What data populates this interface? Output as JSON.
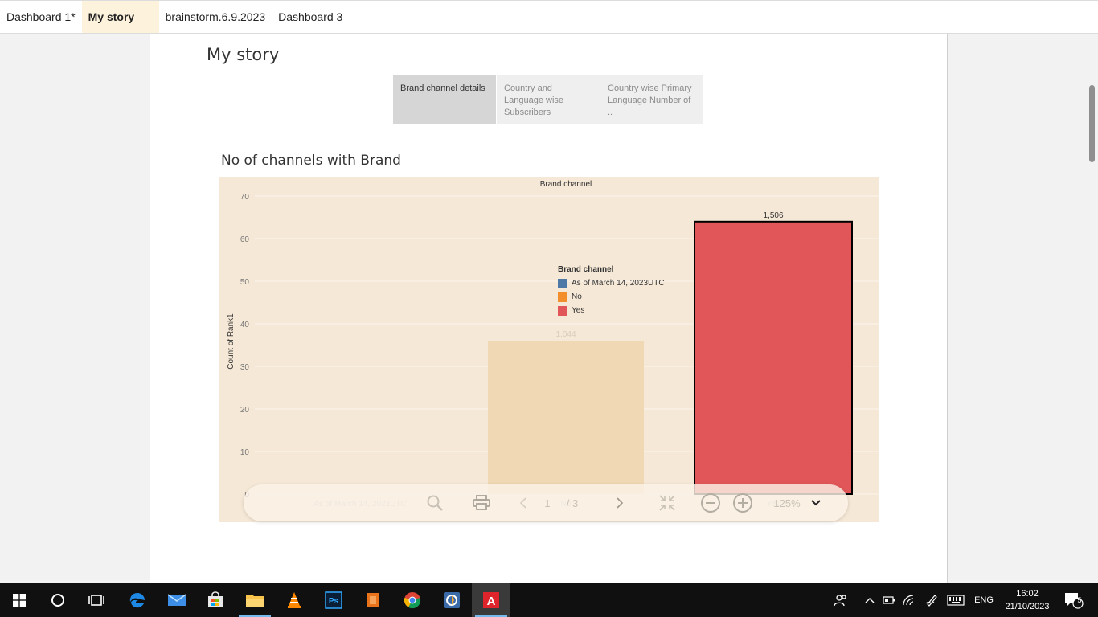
{
  "tabs": [
    {
      "label": "Dashboard 1*"
    },
    {
      "label": "My story",
      "active": true
    },
    {
      "label": "brainstorm.6.9.2023"
    },
    {
      "label": "Dashboard 3"
    }
  ],
  "story": {
    "title": "My story",
    "points": [
      {
        "label": "Brand channel details",
        "active": true
      },
      {
        "label": "Country and Language wise Subscribers"
      },
      {
        "label": "Country wise Primary Language Number of .."
      }
    ]
  },
  "viz": {
    "title": "No of channels with Brand"
  },
  "chart_data": {
    "type": "bar",
    "title": "Brand channel",
    "ylabel": "Count of Rank1",
    "xlabel": "",
    "ylim": [
      0,
      70
    ],
    "yticks": [
      0,
      10,
      20,
      30,
      40,
      50,
      60,
      70
    ],
    "categories": [
      "As of March 14, 2023UTC",
      "No",
      "Yes"
    ],
    "values": [
      0,
      36,
      64
    ],
    "data_labels": [
      "",
      "1,044",
      "1,506"
    ],
    "colors": [
      "#4e79a7",
      "#f28e2b",
      "#e15759"
    ],
    "bar_fill_display": [
      "#4e79a7",
      "#f0d8b4",
      "#e15759"
    ],
    "highlighted": "Yes",
    "legend": {
      "title": "Brand channel",
      "entries": [
        "As of March 14, 2023UTC",
        "No",
        "Yes"
      ]
    },
    "grid": true
  },
  "toolbar": {
    "page_current": "1",
    "page_sep": "/ 3",
    "zoom": "125%"
  },
  "taskbar": {
    "lang": "ENG",
    "time": "16:02",
    "date": "21/10/2023",
    "notifications": "5"
  }
}
